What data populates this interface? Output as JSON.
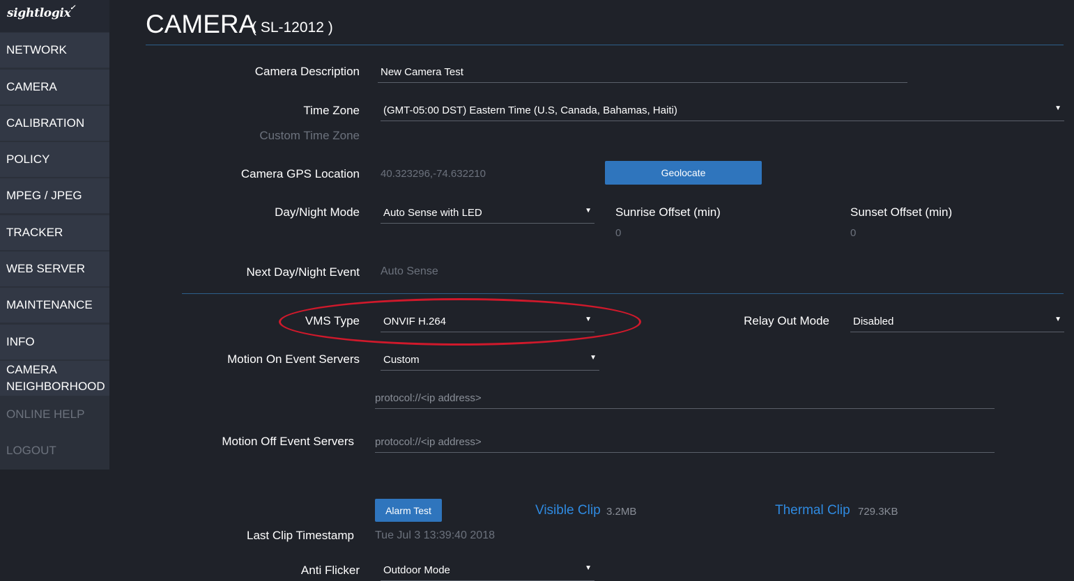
{
  "brand": {
    "logo": "sightlogix"
  },
  "sidebar": {
    "items": [
      {
        "label": "NETWORK"
      },
      {
        "label": "CAMERA"
      },
      {
        "label": "CALIBRATION"
      },
      {
        "label": "POLICY"
      },
      {
        "label": "MPEG / JPEG"
      },
      {
        "label": "TRACKER"
      },
      {
        "label": "WEB SERVER"
      },
      {
        "label": "MAINTENANCE"
      },
      {
        "label": "INFO"
      },
      {
        "label_line1": "CAMERA",
        "label_line2": "NEIGHBORHOOD"
      },
      {
        "label": "ONLINE HELP"
      },
      {
        "label": "LOGOUT"
      }
    ]
  },
  "header": {
    "title": "CAMERA",
    "subtitle": "( SL-12012 )"
  },
  "form": {
    "camera_description": {
      "label": "Camera Description",
      "value": "New Camera Test"
    },
    "time_zone": {
      "label": "Time Zone",
      "value": "(GMT-05:00 DST)  Eastern Time (U.S, Canada, Bahamas, Haiti)"
    },
    "custom_time_zone": {
      "label": "Custom Time Zone"
    },
    "gps": {
      "label": "Camera GPS Location",
      "value": "40.323296,-74.632210",
      "button": "Geolocate"
    },
    "day_night": {
      "label": "Day/Night Mode",
      "value": "Auto Sense with LED"
    },
    "sunrise_offset": {
      "label": "Sunrise Offset (min)",
      "value": "0"
    },
    "sunset_offset": {
      "label": "Sunset Offset (min)",
      "value": "0"
    },
    "next_event": {
      "label": "Next Day/Night Event",
      "value": "Auto Sense"
    },
    "vms_type": {
      "label": "VMS Type",
      "value": "ONVIF H.264"
    },
    "relay_out": {
      "label": "Relay Out Mode",
      "value": "Disabled"
    },
    "motion_on": {
      "label": "Motion On Event Servers",
      "value": "Custom",
      "placeholder": "protocol://<ip address>"
    },
    "motion_off": {
      "label": "Motion Off Event Servers",
      "placeholder": "protocol://<ip address>"
    },
    "alarm_test": {
      "button": "Alarm Test"
    },
    "visible_clip": {
      "label": "Visible Clip",
      "size": "3.2MB"
    },
    "thermal_clip": {
      "label": "Thermal Clip",
      "size": "729.3KB"
    },
    "last_clip": {
      "label": "Last Clip Timestamp",
      "value": "Tue Jul 3 13:39:40 2018"
    },
    "anti_flicker": {
      "label": "Anti Flicker",
      "value": "Outdoor Mode"
    }
  },
  "icons": {
    "dropdown": "chevron-down-icon"
  },
  "colors": {
    "accent": "#2f75bd",
    "link": "#2f8ae0",
    "highlight": "#d0192b",
    "background": "#1f2229",
    "sidebar": "#2b303a"
  }
}
